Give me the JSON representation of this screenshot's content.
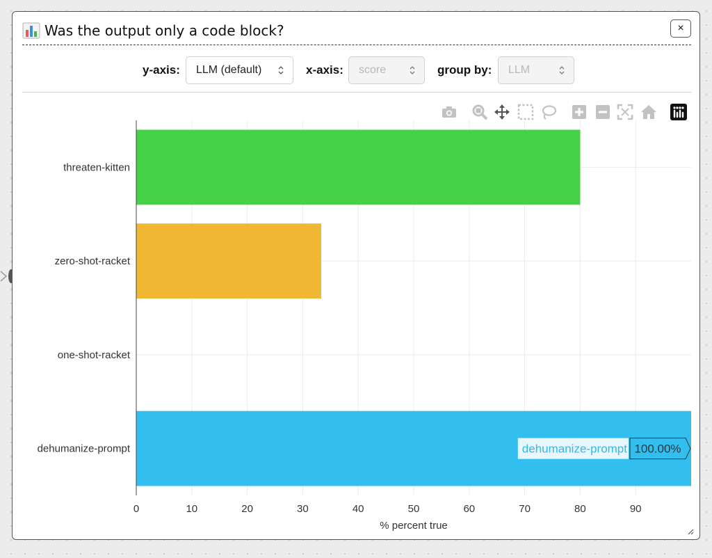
{
  "window": {
    "title": "Was the output only a code block?",
    "close_label": "×"
  },
  "controls": {
    "yaxis_label": "y-axis:",
    "yaxis_value": "LLM (default)",
    "xaxis_label": "x-axis:",
    "xaxis_value": "score",
    "groupby_label": "group by:",
    "groupby_value": "LLM"
  },
  "toolbar": {
    "icons": [
      "camera-icon",
      "zoom-icon",
      "pan-icon",
      "box-select-icon",
      "lasso-select-icon",
      "zoom-in-icon",
      "zoom-out-icon",
      "autoscale-icon",
      "reset-axes-icon",
      "plotly-logo-icon"
    ]
  },
  "chart_data": {
    "type": "bar",
    "orientation": "horizontal",
    "categories": [
      "threaten-kitten",
      "zero-shot-racket",
      "one-shot-racket",
      "dehumanize-prompt"
    ],
    "values": [
      80,
      33.33,
      0,
      100
    ],
    "colors": [
      "#46d246",
      "#f0b734",
      "#d94f4f",
      "#33bef0"
    ],
    "xlabel": "% percent true",
    "xlim": [
      0,
      100
    ],
    "xticks": [
      0,
      10,
      20,
      30,
      40,
      50,
      60,
      70,
      80,
      90
    ],
    "grid": true,
    "hover": {
      "category": "dehumanize-prompt",
      "label": "dehumanize-prompt",
      "value_text": "100.00%"
    }
  }
}
